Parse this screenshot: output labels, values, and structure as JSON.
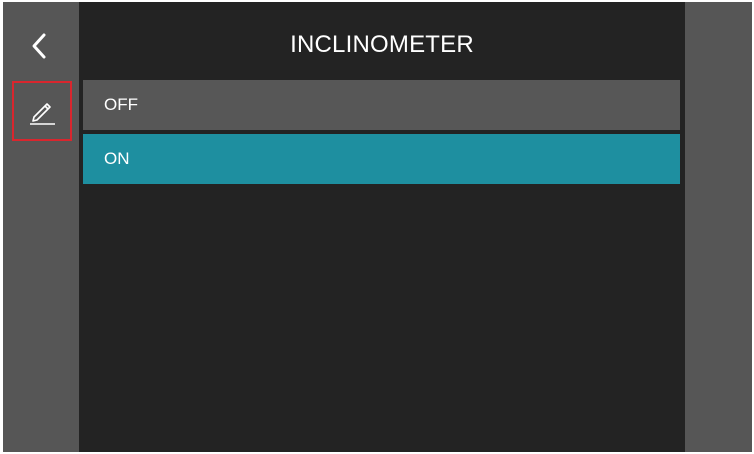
{
  "header": {
    "title": "INCLINOMETER",
    "back_icon": "chevron-left-icon",
    "edit_icon": "pencil-icon"
  },
  "options": [
    {
      "label": "OFF",
      "selected": false
    },
    {
      "label": "ON",
      "selected": true
    }
  ],
  "colors": {
    "rail": "#565656",
    "panel": "#232323",
    "option_default": "#575757",
    "option_selected": "#1e8fa0",
    "highlight_border": "#d9262e",
    "text": "#ffffff"
  }
}
